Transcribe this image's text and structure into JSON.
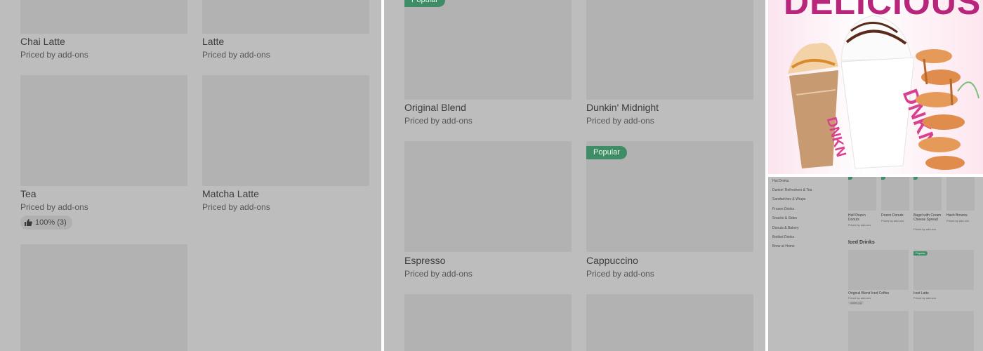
{
  "panel_left": {
    "items": [
      {
        "name": "Chai Latte",
        "price": "Priced by add-ons"
      },
      {
        "name": "Latte",
        "price": "Priced by add-ons"
      },
      {
        "name": "Tea",
        "price": "Priced by add-ons",
        "rating": "100% (3)"
      },
      {
        "name": "Matcha Latte",
        "price": "Priced by add-ons"
      }
    ]
  },
  "panel_middle": {
    "badge_top": "Popular",
    "items": [
      {
        "name": "Original Blend",
        "price": "Priced by add-ons"
      },
      {
        "name": "Dunkin' Midnight",
        "price": "Priced by add-ons"
      },
      {
        "name": "Espresso",
        "price": "Priced by add-ons"
      },
      {
        "name": "Cappuccino",
        "price": "Priced by add-ons",
        "badge": "Popular"
      }
    ]
  },
  "panel_right": {
    "promo_title": "DELICIOUS",
    "cup_brand": "DNKN'",
    "sidebar": [
      "Hot Drinks",
      "Dunkin' Refreshers & Tea",
      "Sandwiches & Wraps",
      "Frozen Drinks",
      "Snacks & Sides",
      "Donuts & Bakery",
      "Bottled Drinks",
      "Brew at Home"
    ],
    "top_items": [
      {
        "name": "Half Dozen Donuts",
        "price": "Priced by add-ons"
      },
      {
        "name": "Dozen Donuts",
        "price": "Priced by add-ons"
      },
      {
        "name": "Bagel with Cream Cheese Spread",
        "price": "Priced by add-ons"
      },
      {
        "name": "Hash Browns",
        "price": "Priced by add-ons"
      }
    ],
    "section_title": "Iced Drinks",
    "iced_items": [
      {
        "name": "Original Blend Iced Coffee",
        "price": "Priced by add-ons",
        "rating": "100% (4)"
      },
      {
        "name": "Iced Latte",
        "price": "Priced by add-ons",
        "badge": "Popular"
      }
    ]
  },
  "colors": {
    "overlay_gray": "#bdbdbd",
    "thumb_gray": "#b2b2b2",
    "badge_green": "#3e8d67",
    "brand_pink": "#b8267c"
  }
}
